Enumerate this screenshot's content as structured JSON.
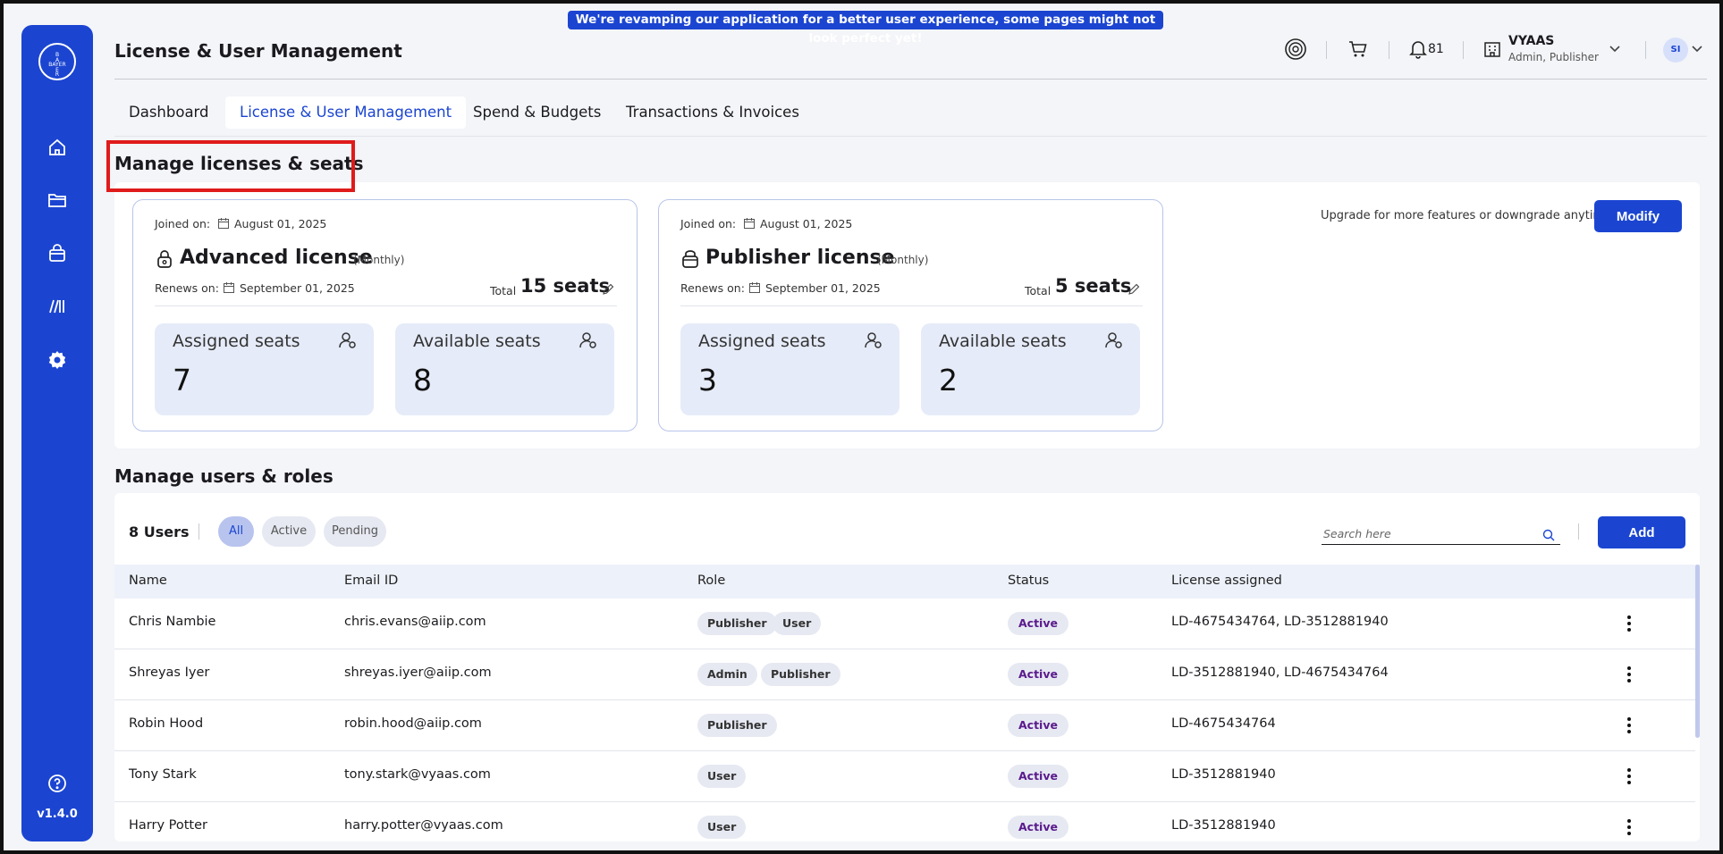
{
  "banner": {
    "text": "We're revamping our application for a better user experience, some pages might not look perfect yet!"
  },
  "sidebar": {
    "logo_text": "BAYER",
    "items": [
      "home-icon",
      "folder-icon",
      "bag-icon",
      "library-icon",
      "settings-icon"
    ],
    "help_icon": "help-icon",
    "version": "v1.4.0"
  },
  "header": {
    "title": "License & User Management",
    "notifications_count": "81",
    "org_name": "VYAAS",
    "org_role": "Admin, Publisher",
    "avatar_initials": "SI"
  },
  "tabs": [
    {
      "label": "Dashboard",
      "active": false
    },
    {
      "label": "License & User Management",
      "active": true
    },
    {
      "label": "Spend & Budgets",
      "active": false
    },
    {
      "label": "Transactions & Invoices",
      "active": false
    }
  ],
  "licenses_section": {
    "title": "Manage licenses & seats",
    "upgrade_text": "Upgrade for more features or downgrade anytime!",
    "modify_label": "Modify",
    "cards": [
      {
        "joined_label": "Joined on:",
        "joined_date": "August 01, 2025",
        "name": "Advanced license",
        "period": "(Monthly)",
        "renews_label": "Renews on:",
        "renews_date": "September 01, 2025",
        "total_label": "Total",
        "total_seats": "15 seats",
        "assigned_label": "Assigned seats",
        "assigned_value": "7",
        "available_label": "Available seats",
        "available_value": "8"
      },
      {
        "joined_label": "Joined on:",
        "joined_date": "August 01, 2025",
        "name": "Publisher license",
        "period": "(Monthly)",
        "renews_label": "Renews on:",
        "renews_date": "September 01, 2025",
        "total_label": "Total",
        "total_seats": "5 seats",
        "assigned_label": "Assigned seats",
        "assigned_value": "3",
        "available_label": "Available seats",
        "available_value": "2"
      }
    ]
  },
  "users_section": {
    "title": "Manage users & roles",
    "count_label": "8 Users",
    "filters": [
      {
        "label": "All",
        "active": true
      },
      {
        "label": "Active",
        "active": false
      },
      {
        "label": "Pending",
        "active": false
      }
    ],
    "search_placeholder": "Search here",
    "add_label": "Add",
    "columns": [
      "Name",
      "Email ID",
      "Role",
      "Status",
      "License assigned"
    ],
    "rows": [
      {
        "name": "Chris Nambie",
        "email": "chris.evans@aiip.com",
        "roles": [
          "Publisher",
          "User"
        ],
        "status": "Active",
        "licenses": "LD-4675434764, LD-3512881940"
      },
      {
        "name": "Shreyas Iyer",
        "email": "shreyas.iyer@aiip.com",
        "roles": [
          "Admin",
          "Publisher"
        ],
        "status": "Active",
        "licenses": "LD-3512881940, LD-4675434764"
      },
      {
        "name": "Robin Hood",
        "email": "robin.hood@aiip.com",
        "roles": [
          "Publisher"
        ],
        "status": "Active",
        "licenses": "LD-4675434764"
      },
      {
        "name": "Tony Stark",
        "email": "tony.stark@vyaas.com",
        "roles": [
          "User"
        ],
        "status": "Active",
        "licenses": "LD-3512881940"
      },
      {
        "name": "Harry Potter",
        "email": "harry.potter@vyaas.com",
        "roles": [
          "User"
        ],
        "status": "Active",
        "licenses": "LD-3512881940"
      }
    ]
  },
  "colors": {
    "primary": "#1b45d1",
    "highlight": "#e01b1b",
    "status_text": "#5a1a8c"
  }
}
